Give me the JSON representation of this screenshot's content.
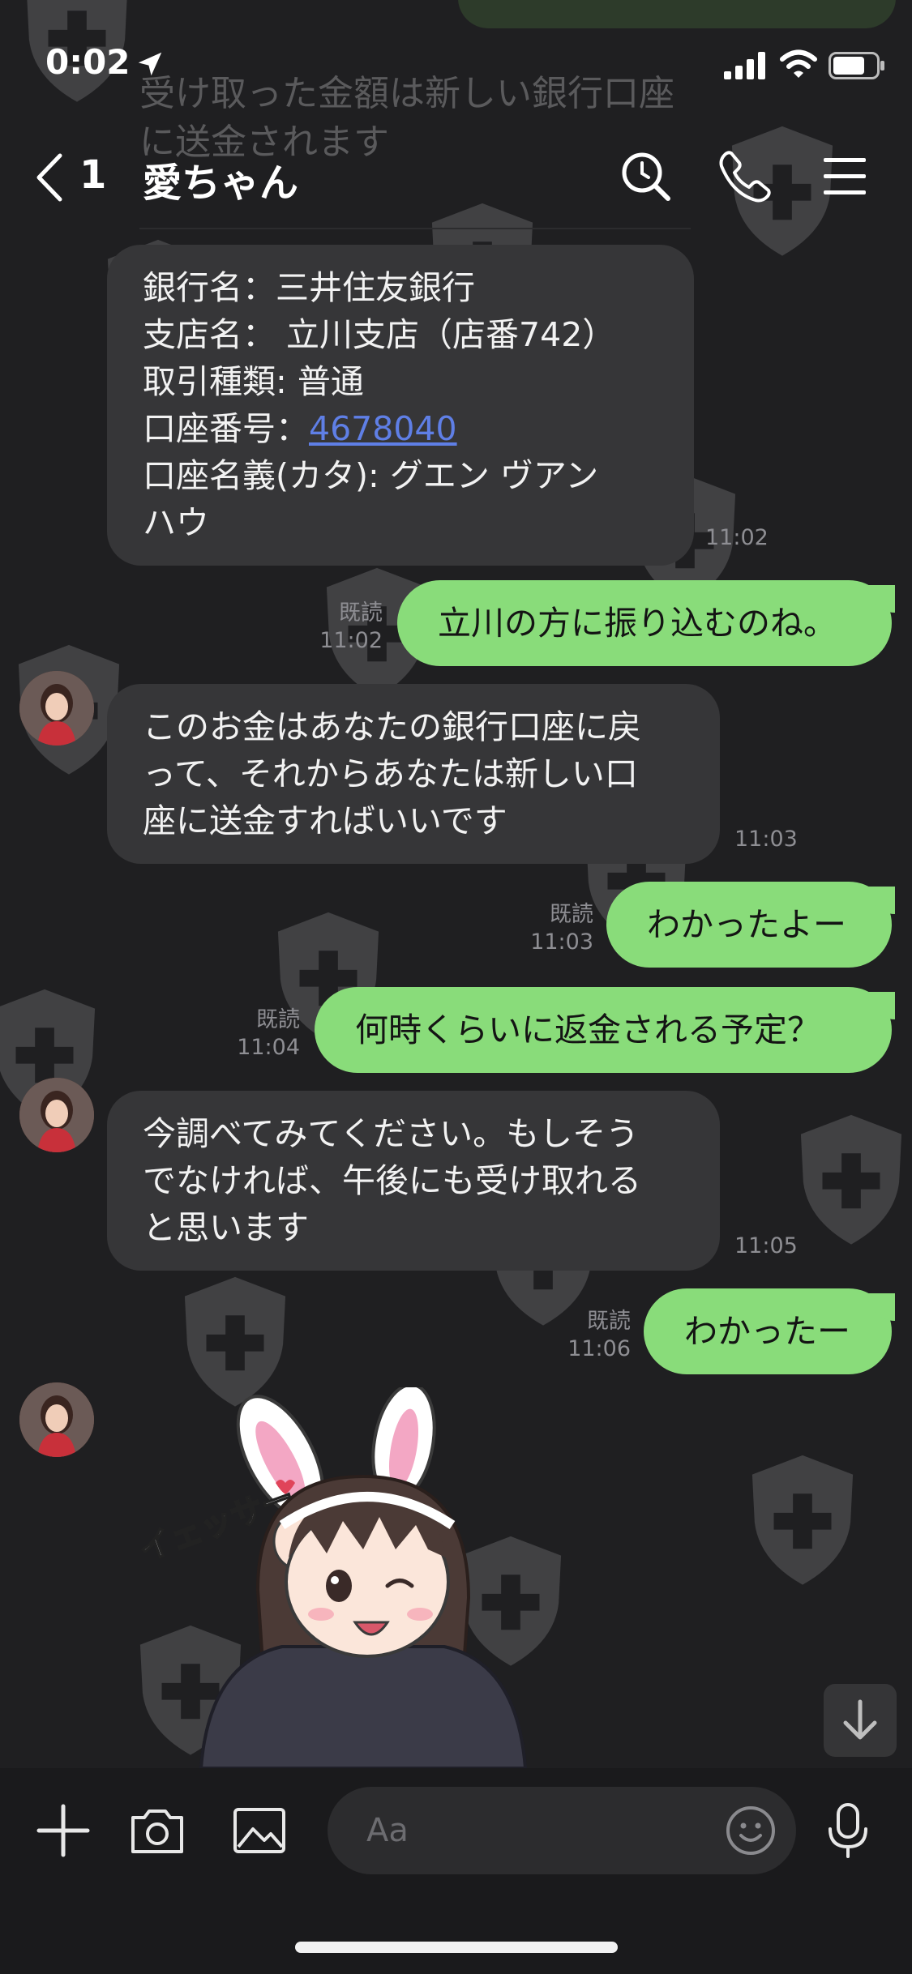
{
  "status_bar": {
    "time": "0:02"
  },
  "header": {
    "back_count": "1",
    "title": "愛ちゃん"
  },
  "ghost_text": [
    "受け取った金額は新しい銀行口座",
    "に送金されます"
  ],
  "messages": [
    {
      "lines": [
        "銀行名：三井住友銀行",
        "支店名： 立川支店（店番742）",
        "取引種類: 普通"
      ],
      "account_label": "口座番号：",
      "account_number": "4678040",
      "lines2": [
        "口座名義(カタ): グエン ヴアン",
        "ハウ"
      ],
      "time": "11:02"
    },
    {
      "text": "立川の方に振り込むのね。",
      "read": "既読",
      "time": "11:02"
    },
    {
      "lines": [
        "このお金はあなたの銀行口座に戻",
        "って、それからあなたは新しい口",
        "座に送金すればいいです"
      ],
      "time": "11:03"
    },
    {
      "text": "わかったよー",
      "read": "既読",
      "time": "11:03"
    },
    {
      "text": "何時くらいに返金される予定？",
      "read": "既読",
      "time": "11:04"
    },
    {
      "lines": [
        "今調べてみてください。もしそう",
        "でなければ、午後にも受け取れる",
        "と思います"
      ],
      "time": "11:05"
    },
    {
      "text": "わかったー",
      "read": "既読",
      "time": "11:06"
    }
  ],
  "sticker": {
    "caption": "イェッサー"
  },
  "composer": {
    "placeholder": "Aa"
  },
  "colors": {
    "background": "#1f1f21",
    "incoming_bubble": "#363638",
    "outgoing_bubble": "#89dc7a",
    "link": "#5f7fe6"
  }
}
